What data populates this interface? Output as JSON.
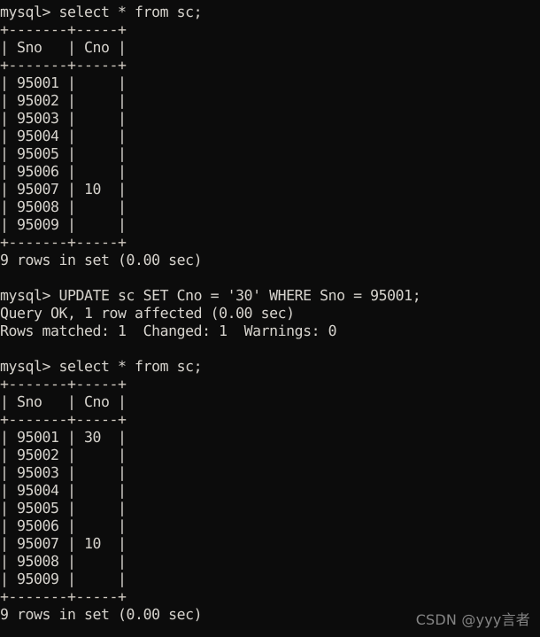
{
  "terminal": {
    "app": "mysql-client-terminal",
    "background_color": "#0c0c0c",
    "text_color": "#d6d3cd",
    "prompt": "mysql>",
    "lines": [
      "mysql> select * from sc;",
      "+-------+-----+",
      "| Sno   | Cno |",
      "+-------+-----+",
      "| 95001 |     |",
      "| 95002 |     |",
      "| 95003 |     |",
      "| 95004 |     |",
      "| 95005 |     |",
      "| 95006 |     |",
      "| 95007 | 10  |",
      "| 95008 |     |",
      "| 95009 |     |",
      "+-------+-----+",
      "9 rows in set (0.00 sec)",
      "",
      "mysql> UPDATE sc SET Cno = '30' WHERE Sno = 95001;",
      "Query OK, 1 row affected (0.00 sec)",
      "Rows matched: 1  Changed: 1  Warnings: 0",
      "",
      "mysql> select * from sc;",
      "+-------+-----+",
      "| Sno   | Cno |",
      "+-------+-----+",
      "| 95001 | 30  |",
      "| 95002 |     |",
      "| 95003 |     |",
      "| 95004 |     |",
      "| 95005 |     |",
      "| 95006 |     |",
      "| 95007 | 10  |",
      "| 95008 |     |",
      "| 95009 |     |",
      "+-------+-----+",
      "9 rows in set (0.00 sec)"
    ],
    "commands": [
      "select * from sc;",
      "UPDATE sc SET Cno = '30' WHERE Sno = 95001;",
      "select * from sc;"
    ],
    "result_tables": [
      {
        "columns": [
          "Sno",
          "Cno"
        ],
        "rows": [
          [
            "95001",
            ""
          ],
          [
            "95002",
            ""
          ],
          [
            "95003",
            ""
          ],
          [
            "95004",
            ""
          ],
          [
            "95005",
            ""
          ],
          [
            "95006",
            ""
          ],
          [
            "95007",
            "10"
          ],
          [
            "95008",
            ""
          ],
          [
            "95009",
            ""
          ]
        ],
        "footer": "9 rows in set (0.00 sec)"
      },
      {
        "columns": [
          "Sno",
          "Cno"
        ],
        "rows": [
          [
            "95001",
            "30"
          ],
          [
            "95002",
            ""
          ],
          [
            "95003",
            ""
          ],
          [
            "95004",
            ""
          ],
          [
            "95005",
            ""
          ],
          [
            "95006",
            ""
          ],
          [
            "95007",
            "10"
          ],
          [
            "95008",
            ""
          ],
          [
            "95009",
            ""
          ]
        ],
        "footer": "9 rows in set (0.00 sec)"
      }
    ],
    "status_messages": [
      "Query OK, 1 row affected (0.00 sec)",
      "Rows matched: 1  Changed: 1  Warnings: 0"
    ]
  },
  "watermark": {
    "text": "CSDN @yyy言者",
    "color": "#8f8f8f"
  }
}
